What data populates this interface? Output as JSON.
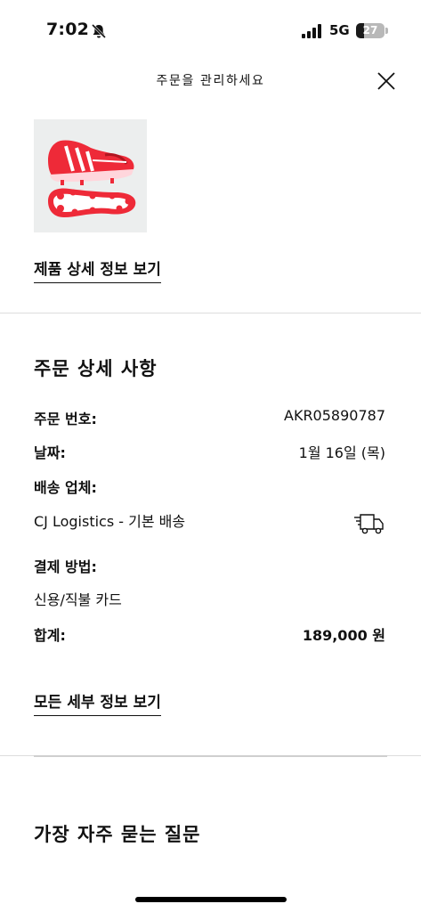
{
  "status_bar": {
    "time": "7:02",
    "network": "5G",
    "battery": "27",
    "battery_level": 0.27
  },
  "header": {
    "title": "주문을 관리하세요"
  },
  "product": {
    "details_link": "제품 상세 정보 보기"
  },
  "order_details": {
    "title": "주문 상세 사항",
    "order_number_label": "주문 번호:",
    "order_number": "AKR05890787",
    "date_label": "날짜:",
    "date": "1월 16일 (목)",
    "carrier_label": "배송 업체:",
    "carrier": "CJ Logistics - 기본 배송",
    "payment_label": "결제 방법:",
    "payment": "신용/직불 카드",
    "total_label": "합계:",
    "total": "189,000 원",
    "all_details_link": "모든 세부 정보 보기"
  },
  "faq": {
    "title": "가장 자주 묻는 질문"
  },
  "colors": {
    "shoe_red": "#ee2a38",
    "image_bg": "#eceeee"
  }
}
